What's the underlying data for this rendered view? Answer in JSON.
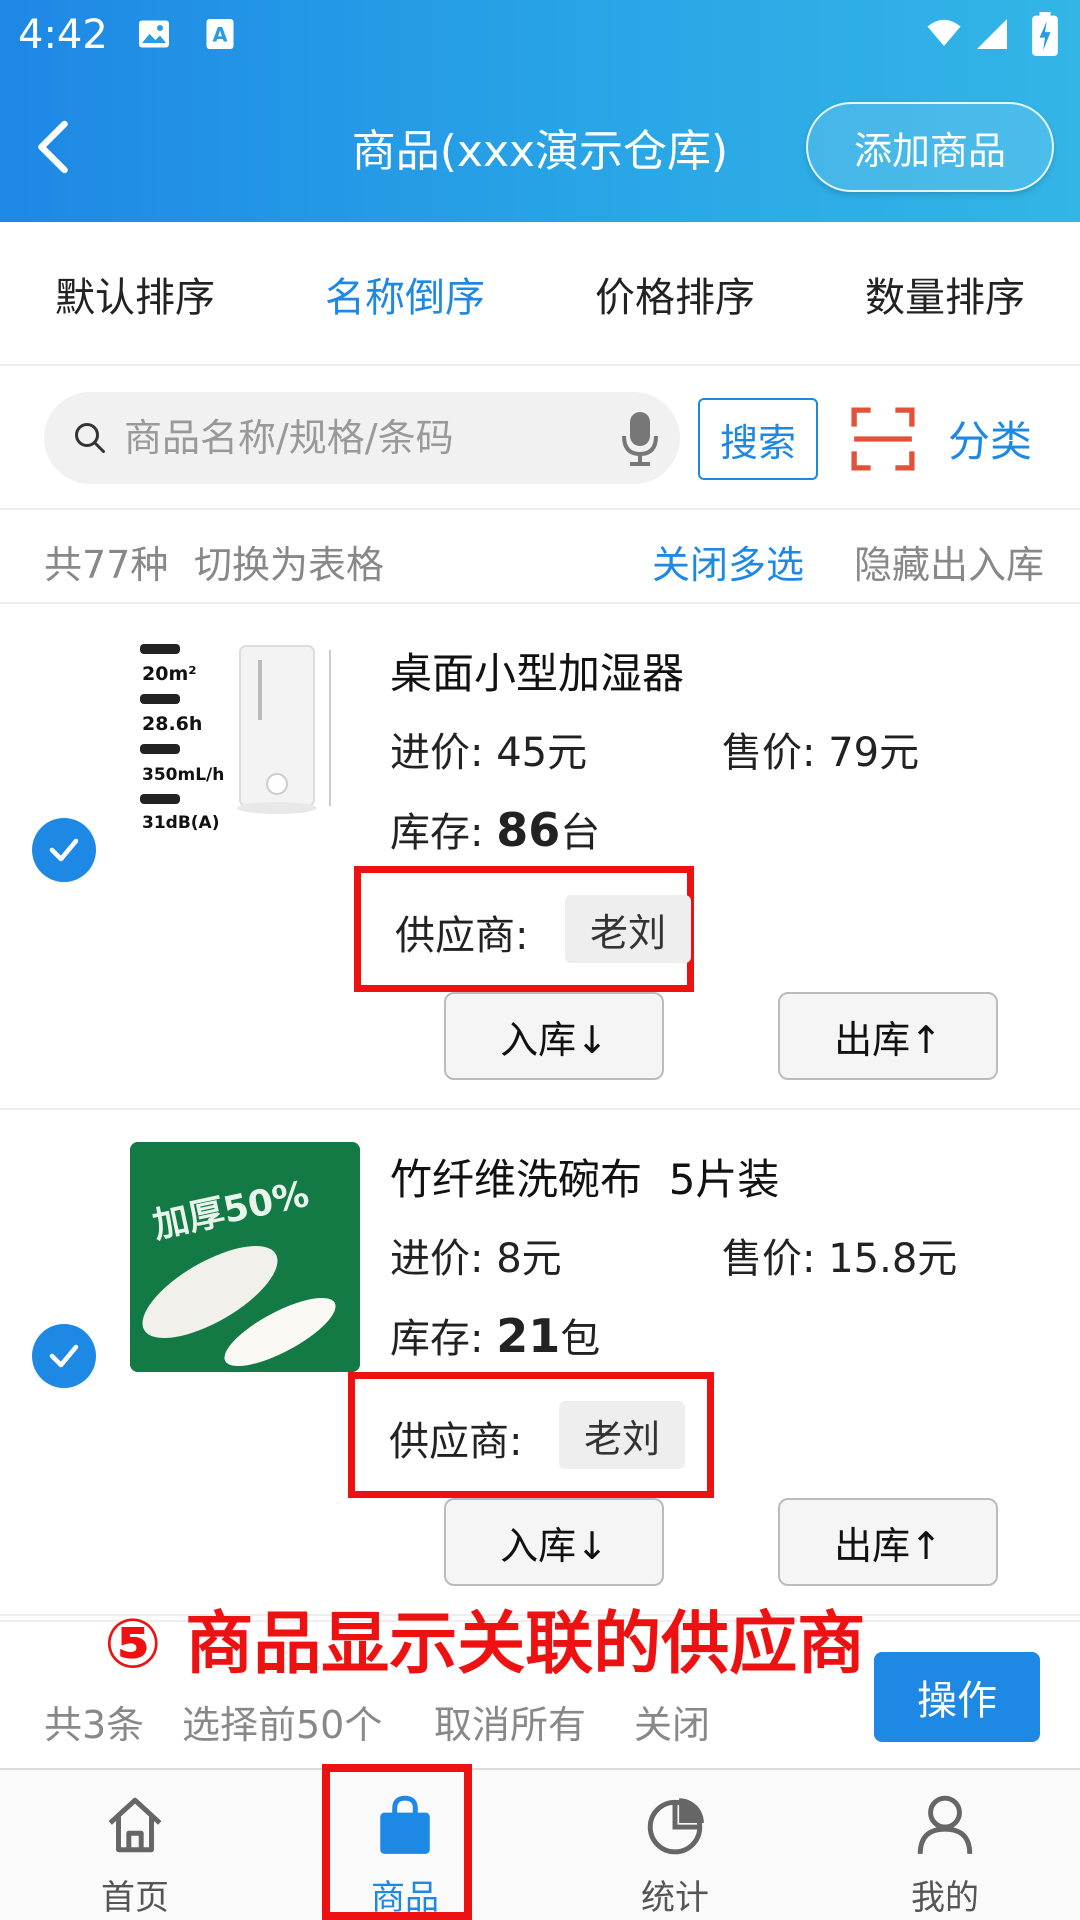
{
  "status_bar": {
    "time": "4:42"
  },
  "app_bar": {
    "title": "商品(xxx演示仓库)",
    "add_button": "添加商品"
  },
  "sort_tabs": [
    {
      "label": "默认排序",
      "active": false
    },
    {
      "label": "名称倒序",
      "active": true
    },
    {
      "label": "价格排序",
      "active": false
    },
    {
      "label": "数量排序",
      "active": false
    }
  ],
  "search": {
    "placeholder": "商品名称/规格/条码",
    "button": "搜索",
    "category": "分类"
  },
  "info_bar": {
    "count": "共77种",
    "switch_view": "切换为表格",
    "close_multi": "关闭多选",
    "hide_io": "隐藏出入库"
  },
  "products": [
    {
      "name": "桌面小型加湿器",
      "buy_label": "进价:",
      "buy_value": "45元",
      "sell_label": "售价:",
      "sell_value": "79元",
      "stock_label": "库存:",
      "stock_qty": "86",
      "stock_unit": "台",
      "supplier_label": "供应商:",
      "supplier": "老刘",
      "in_button": "入库↓",
      "out_button": "出库↑",
      "selected": true,
      "thumb_text": [
        "20m²",
        "28.6h",
        "350mL/h",
        "31dB(A)"
      ]
    },
    {
      "name": "竹纤维洗碗布  5片装",
      "buy_label": "进价:",
      "buy_value": "8元",
      "sell_label": "售价:",
      "sell_value": "15.8元",
      "stock_label": "库存:",
      "stock_qty": "21",
      "stock_unit": "包",
      "supplier_label": "供应商:",
      "supplier": "老刘",
      "in_button": "入库↓",
      "out_button": "出库↑",
      "selected": true,
      "thumb_text": [
        "加厚50%"
      ]
    }
  ],
  "annotation": "⑤ 商品显示关联的供应商",
  "select_bar": {
    "count": "共3条",
    "select_first": "选择前50个",
    "cancel_all": "取消所有",
    "close": "关闭",
    "action": "操作"
  },
  "bottom_nav": [
    {
      "label": "首页",
      "icon": "home-icon",
      "active": false
    },
    {
      "label": "商品",
      "icon": "shopping-bag-icon",
      "active": true
    },
    {
      "label": "统计",
      "icon": "pie-chart-icon",
      "active": false
    },
    {
      "label": "我的",
      "icon": "person-icon",
      "active": false
    }
  ],
  "colors": {
    "primary": "#1e88e5",
    "annotation_red": "#ee1111",
    "header_gradient_end": "#33b5e6"
  }
}
